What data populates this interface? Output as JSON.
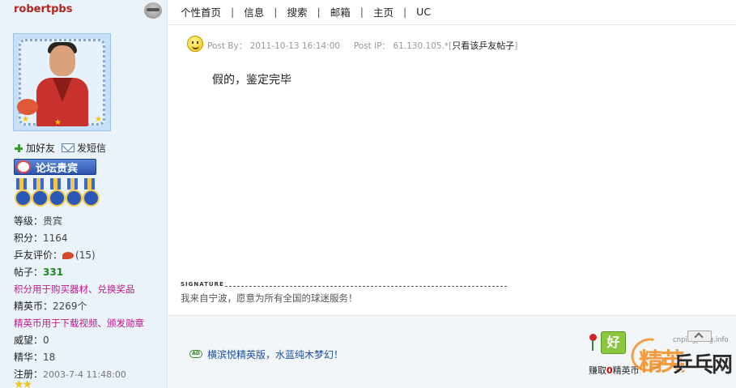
{
  "user": {
    "name": "robertpbs",
    "actions": {
      "add_friend": "加好友",
      "send_message": "发短信"
    },
    "title_badge": "论坛贵宾",
    "stats": {
      "level_label": "等级：",
      "level_value": "贵宾",
      "points_label": "积分：",
      "points_value": "1164",
      "rating_label": "乒友评价：",
      "rating_value": "(15)",
      "posts_label": "帖子：",
      "posts_value": "331",
      "points_promo": "积分用于购买器材、兑换奖品",
      "coins_label": "精英币：",
      "coins_value": "2269个",
      "coins_promo": "精英币用于下载视频、颁发勋章",
      "prestige_label": "威望：",
      "prestige_value": "0",
      "essence_label": "精华：",
      "essence_value": "18",
      "registered_label": "注册：",
      "registered_value": "2003-7-4 11:48:00"
    }
  },
  "nav": [
    "个性首页",
    "信息",
    "搜索",
    "邮箱",
    "主页",
    "UC"
  ],
  "post": {
    "meta_by_label": "Post By：",
    "meta_time": "2011-10-13 16:14:00",
    "meta_ip_label": "Post IP：",
    "meta_ip": "61.130.105.*",
    "only_this_user": "只看该乒友帖子",
    "body": "假的，鉴定完毕",
    "signature_label": "SIGNATURE",
    "signature": "我来自宁波，愿意为所有全国的球迷服务！"
  },
  "footer": {
    "ad_badge": "AD",
    "ad_text": "横滨悦精英版，水蓝纯木梦幻！",
    "good_label": "好",
    "earn_prefix": "赚取",
    "earn_value": "0",
    "earn_suffix": "精英币"
  },
  "watermark": {
    "url": "cnpingpang.info",
    "brand_a": "精英",
    "brand_b": "乒乓网"
  },
  "icons": {
    "online": "online-status-icon",
    "add_friend": "plus-icon",
    "message": "mail-icon",
    "post_mood": "smiley-icon",
    "rose": "rose-icon",
    "back_to_top": "back-to-top-icon"
  },
  "colors": {
    "username": "#b3261e",
    "promo": "#c0188a",
    "posts": "#1b8a1b",
    "sidebar_bg": "#eaf2fa",
    "link": "#1a4fa0",
    "watermark_orange": "#f08c1e"
  }
}
